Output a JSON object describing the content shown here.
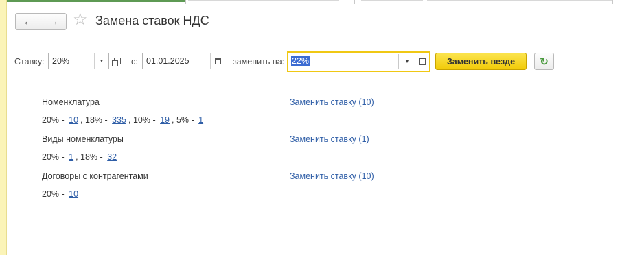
{
  "header": {
    "back_icon": "←",
    "forward_icon": "→",
    "favorite_icon": "☆",
    "title": "Замена ставок НДС"
  },
  "filters": {
    "rate_label": "Ставку:",
    "rate_value": "20%",
    "date_label": "с:",
    "date_value": "01.01.2025",
    "replace_with_label": "заменить на:",
    "replace_with_value": "22%",
    "dropdown_icon": "▼",
    "replace_all_label": "Заменить везде",
    "refresh_icon": "↻"
  },
  "sections": [
    {
      "title": "Номенклатура",
      "action": "Заменить ставку (10)",
      "rates": [
        {
          "label": "20% - ",
          "count": "10",
          "sep": ", "
        },
        {
          "label": "18% - ",
          "count": "335",
          "sep": ", "
        },
        {
          "label": "10% - ",
          "count": "19",
          "sep": ", "
        },
        {
          "label": "5% - ",
          "count": "1",
          "sep": ""
        }
      ]
    },
    {
      "title": "Виды номенклатуры",
      "action": "Заменить ставку (1)",
      "rates": [
        {
          "label": "20% - ",
          "count": "1",
          "sep": ", "
        },
        {
          "label": "18% - ",
          "count": "32",
          "sep": ""
        }
      ]
    },
    {
      "title": "Договоры с контрагентами",
      "action": "Заменить ставку (10)",
      "rates": [
        {
          "label": "20% - ",
          "count": "10",
          "sep": ""
        }
      ]
    }
  ]
}
